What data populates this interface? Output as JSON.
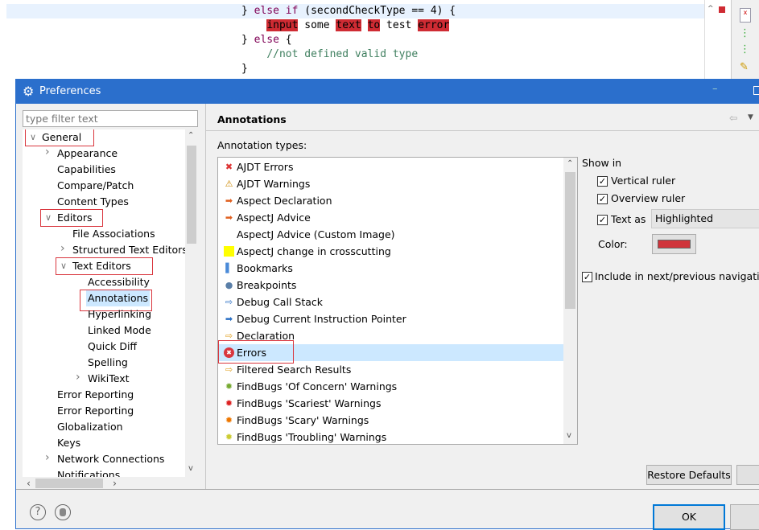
{
  "editor": {
    "lines": [
      {
        "parts": [
          {
            "t": "} ",
            "c": ""
          },
          {
            "t": "else",
            "c": "kw"
          },
          {
            "t": " ",
            "c": ""
          },
          {
            "t": "if",
            "c": "kw"
          },
          {
            "t": " (secondCheckType == 4) {",
            "c": ""
          }
        ]
      },
      {
        "parts": [
          {
            "t": "    ",
            "c": ""
          },
          {
            "t": "input",
            "c": "hl"
          },
          {
            "t": " some ",
            "c": ""
          },
          {
            "t": "text",
            "c": "hl"
          },
          {
            "t": " ",
            "c": ""
          },
          {
            "t": "to",
            "c": "hl"
          },
          {
            "t": " test ",
            "c": ""
          },
          {
            "t": "error",
            "c": "hl"
          }
        ]
      },
      {
        "parts": [
          {
            "t": "} ",
            "c": ""
          },
          {
            "t": "else",
            "c": "kw"
          },
          {
            "t": " {",
            "c": ""
          }
        ]
      },
      {
        "parts": [
          {
            "t": "    ",
            "c": ""
          },
          {
            "t": "//not defined valid type",
            "c": "cm"
          }
        ]
      },
      {
        "parts": [
          {
            "t": "}",
            "c": ""
          }
        ]
      }
    ]
  },
  "dialog": {
    "title": "Preferences",
    "filter_placeholder": "type filter text",
    "tree": [
      {
        "label": "General",
        "level": 0,
        "arrow": "expanded",
        "boxed": true
      },
      {
        "label": "Appearance",
        "level": 1,
        "arrow": "collapsed"
      },
      {
        "label": "Capabilities",
        "level": 1
      },
      {
        "label": "Compare/Patch",
        "level": 1
      },
      {
        "label": "Content Types",
        "level": 1
      },
      {
        "label": "Editors",
        "level": 1,
        "arrow": "expanded",
        "boxed": true
      },
      {
        "label": "File Associations",
        "level": 2
      },
      {
        "label": "Structured Text Editors",
        "level": 2,
        "arrow": "collapsed"
      },
      {
        "label": "Text Editors",
        "level": 2,
        "arrow": "expanded",
        "boxed": true
      },
      {
        "label": "Accessibility",
        "level": 3
      },
      {
        "label": "Annotations",
        "level": 3,
        "selected": true,
        "boxed": true
      },
      {
        "label": "Hyperlinking",
        "level": 3
      },
      {
        "label": "Linked Mode",
        "level": 3
      },
      {
        "label": "Quick Diff",
        "level": 3
      },
      {
        "label": "Spelling",
        "level": 3
      },
      {
        "label": "WikiText",
        "level": 3,
        "arrow": "collapsed"
      },
      {
        "label": "Error Reporting",
        "level": 1
      },
      {
        "label": "Error Reporting",
        "level": 1
      },
      {
        "label": "Globalization",
        "level": 1
      },
      {
        "label": "Keys",
        "level": 1
      },
      {
        "label": "Network Connections",
        "level": 1,
        "arrow": "collapsed"
      },
      {
        "label": "Notifications",
        "level": 1
      }
    ],
    "page_title": "Annotations",
    "types_label": "Annotation types:",
    "annotation_types": [
      {
        "label": "AJDT Errors",
        "icon": "ajdt-error-icon"
      },
      {
        "label": "AJDT Warnings",
        "icon": "ajdt-warning-icon"
      },
      {
        "label": "Aspect Declaration",
        "icon": "orange-arrow-icon"
      },
      {
        "label": "AspectJ Advice",
        "icon": "orange-arrow-icon"
      },
      {
        "label": "AspectJ Advice (Custom Image)",
        "icon": ""
      },
      {
        "label": "AspectJ change in crosscutting",
        "icon": "yellow-square-icon"
      },
      {
        "label": "Bookmarks",
        "icon": "bookmark-icon"
      },
      {
        "label": "Breakpoints",
        "icon": "breakpoint-icon"
      },
      {
        "label": "Debug Call Stack",
        "icon": "blue-outline-arrow-icon"
      },
      {
        "label": "Debug Current Instruction Pointer",
        "icon": "blue-arrow-icon"
      },
      {
        "label": "Declaration",
        "icon": "yellow-arrow-icon"
      },
      {
        "label": "Errors",
        "icon": "error-icon",
        "selected": true,
        "boxed": true
      },
      {
        "label": "Filtered Search Results",
        "icon": "yellow-arrow-icon"
      },
      {
        "label": "FindBugs 'Of Concern' Warnings",
        "icon": "bug-green-icon"
      },
      {
        "label": "FindBugs 'Scariest' Warnings",
        "icon": "bug-red-icon"
      },
      {
        "label": "FindBugs 'Scary' Warnings",
        "icon": "bug-orange-icon"
      },
      {
        "label": "FindBugs 'Troubling' Warnings",
        "icon": "bug-yellow-icon"
      }
    ],
    "show_in": "Show in",
    "vertical_ruler": {
      "label": "Vertical ruler",
      "checked": true
    },
    "overview_ruler": {
      "label": "Overview ruler",
      "checked": true
    },
    "text_as": {
      "label": "Text as",
      "checked": true,
      "value": "Highlighted"
    },
    "color_label": "Color:",
    "color_value": "#d0343b",
    "include_nav": {
      "label": "Include in next/previous navigation",
      "checked": true
    },
    "restore_defaults": "Restore Defaults",
    "ok": "OK"
  },
  "colors": {
    "title_bar": "#2b6fcc",
    "highlight": "#cf2b33",
    "selection": "#cce8ff",
    "annotation_box": "#d9363e"
  }
}
